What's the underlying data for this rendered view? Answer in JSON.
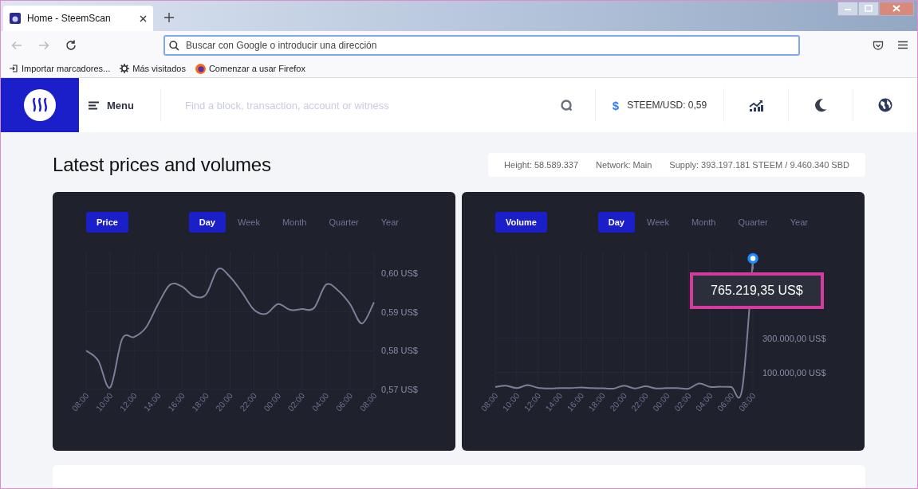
{
  "browser": {
    "tab": {
      "title": "Home - SteemScan",
      "selected": true
    },
    "address_bar": {
      "placeholder": "Buscar con Google o introducir una dirección"
    },
    "bookmarks": [
      {
        "kind": "import",
        "label": "Importar marcadores..."
      },
      {
        "kind": "gear",
        "label": "Más visitados"
      },
      {
        "kind": "firefox",
        "label": "Comenzar a usar Firefox"
      }
    ]
  },
  "header": {
    "menu_label": "Menu",
    "search": {
      "placeholder": "Find a block, transaction, account or witness"
    },
    "price_ticker": {
      "symbol": "$",
      "label": "STEEM/USD: 0,59"
    }
  },
  "page": {
    "title": "Latest prices and volumes",
    "stats": [
      "Height: 58.589.337",
      "Network: Main",
      "Supply: 393.197.181 STEEM / 9.460.340 SBD"
    ]
  },
  "panels": [
    {
      "label": "Price",
      "periods": [
        {
          "label": "Day",
          "selected": true
        },
        {
          "label": "Week",
          "selected": false
        },
        {
          "label": "Month",
          "selected": false
        },
        {
          "label": "Quarter",
          "selected": false
        },
        {
          "label": "Year",
          "selected": false
        }
      ],
      "chart_data": {
        "type": "line",
        "categories": [
          "08:00",
          null,
          "10:00",
          null,
          "12:00",
          null,
          "14:00",
          null,
          "16:00",
          null,
          "18:00",
          null,
          "20:00",
          null,
          "22:00",
          null,
          "00:00",
          null,
          "02:00",
          null,
          "04:00",
          null,
          "06:00",
          null,
          "08:00"
        ],
        "grid": true,
        "ylim": [
          0.57,
          0.6055
        ],
        "yticks": [
          {
            "value": 0.6,
            "label": "0,60 US$"
          },
          {
            "value": 0.59,
            "label": "0,59 US$"
          },
          {
            "value": 0.58,
            "label": "0,58 US$"
          },
          {
            "value": 0.57,
            "label": "0,57 US$"
          }
        ],
        "series": [
          {
            "color": "#7b8099",
            "values": [
              0.58,
              0.5775,
              0.5705,
              0.583,
              0.5835,
              0.586,
              0.592,
              0.597,
              0.5965,
              0.594,
              0.5945,
              0.601,
              0.599,
              0.595,
              0.5905,
              0.5895,
              0.592,
              0.5905,
              0.5907,
              0.591,
              0.597,
              0.5955,
              0.592,
              0.587,
              0.5925
            ]
          }
        ]
      }
    },
    {
      "label": "Volume",
      "periods": [
        {
          "label": "Day",
          "selected": true
        },
        {
          "label": "Week",
          "selected": false
        },
        {
          "label": "Month",
          "selected": false
        },
        {
          "label": "Quarter",
          "selected": false
        },
        {
          "label": "Year",
          "selected": false
        }
      ],
      "tooltip": {
        "text": "765.219,35 US$",
        "highlighted": true
      },
      "chart_data": {
        "type": "line",
        "categories": [
          "08:00",
          null,
          "10:00",
          null,
          "12:00",
          null,
          "14:00",
          null,
          "16:00",
          null,
          "18:00",
          null,
          "20:00",
          null,
          "22:00",
          null,
          "00:00",
          null,
          "02:00",
          null,
          "04:00",
          null,
          "06:00",
          null,
          "08:00"
        ],
        "grid": true,
        "ylim": [
          0,
          805000
        ],
        "yticks": [
          {
            "value": 300000,
            "label": "300.000,00 US$"
          },
          {
            "value": 100000,
            "label": "100.000,00 US$"
          }
        ],
        "series": [
          {
            "color": "#7b8099",
            "values": [
              15000,
              22000,
              8000,
              25000,
              10000,
              6000,
              8000,
              8000,
              12000,
              8000,
              7000,
              5000,
              22000,
              6000,
              18000,
              6000,
              8000,
              8000,
              5000,
              35000,
              15000,
              16000,
              14000,
              4000,
              765000
            ]
          }
        ]
      }
    }
  ]
}
